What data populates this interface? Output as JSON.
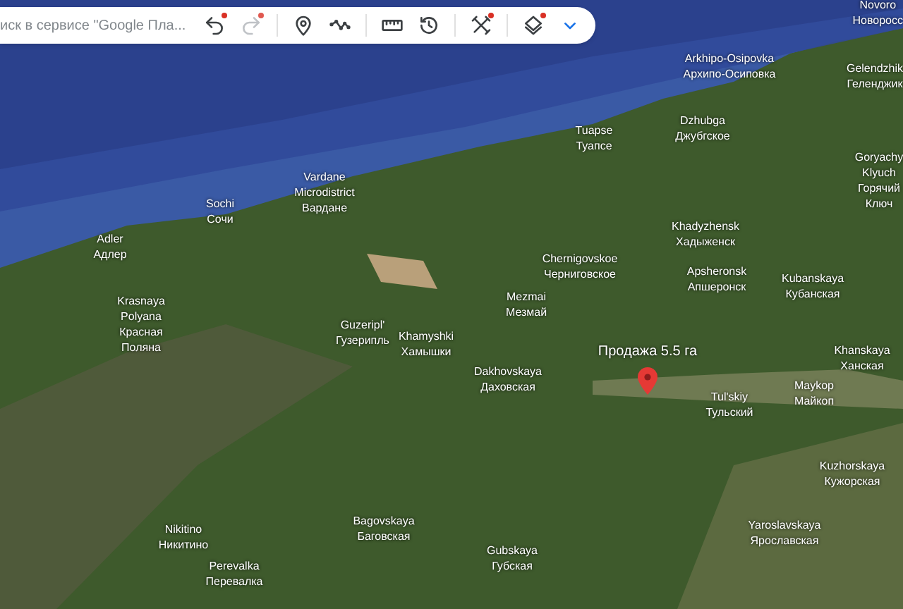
{
  "search": {
    "placeholder": "иск в сервисе \"Google Пла..."
  },
  "toolbar": [
    {
      "kind": "undo",
      "disabled": false,
      "badge": true
    },
    {
      "kind": "redo",
      "disabled": true,
      "badge": true
    },
    {
      "kind": "divider"
    },
    {
      "kind": "pin",
      "disabled": false,
      "badge": false
    },
    {
      "kind": "path",
      "disabled": false,
      "badge": false
    },
    {
      "kind": "divider"
    },
    {
      "kind": "ruler",
      "disabled": false,
      "badge": false
    },
    {
      "kind": "history",
      "disabled": false,
      "badge": false
    },
    {
      "kind": "divider"
    },
    {
      "kind": "tools",
      "disabled": false,
      "badge": true
    },
    {
      "kind": "divider"
    },
    {
      "kind": "layers",
      "disabled": false,
      "badge": true
    },
    {
      "kind": "expand",
      "disabled": false,
      "badge": false
    }
  ],
  "map": {
    "placemark": {
      "label": "Продажа 5.5 га"
    },
    "places": [
      [
        "Novoro",
        "Новоросс"
      ],
      [
        "Arkhipo-Osipovka",
        "Архипо-Осиповка"
      ],
      [
        "Gelendzhik",
        "Геленджик"
      ],
      [
        "Dzhubga",
        "Джубгское"
      ],
      [
        "Tuapse",
        "Туапсе"
      ],
      [
        "Goryachy",
        "Klyuch",
        "Горячий",
        "Ключ"
      ],
      [
        "Vardane",
        "Microdistrict",
        "Вардане"
      ],
      [
        "Sochi",
        "Сочи"
      ],
      [
        "Adler",
        "Адлер"
      ],
      [
        "Khadyzhensk",
        "Хадыженск"
      ],
      [
        "Chernigovskoe",
        "Черниговское"
      ],
      [
        "Apsheronsk",
        "Апшеронск"
      ],
      [
        "Kubanskaya",
        "Кубанская"
      ],
      [
        "Krasnaya",
        "Polyana",
        "Красная",
        "Поляна"
      ],
      [
        "Mezmai",
        "Мезмай"
      ],
      [
        "Guzeripl'",
        "Гузерипль"
      ],
      [
        "Khamyshki",
        "Хамышки"
      ],
      [
        "Dakhovskaya",
        "Даховская"
      ],
      [
        "Khanskaya",
        "Ханская"
      ],
      [
        "Maykop",
        "Майкоп"
      ],
      [
        "Tul'skiy",
        "Тульский"
      ],
      [
        "Kuzhorskaya",
        "Кужорская"
      ],
      [
        "Nikitino",
        "Никитино"
      ],
      [
        "Bagovskaya",
        "Баговская"
      ],
      [
        "Yaroslavskaya",
        "Ярославская"
      ],
      [
        "Perevalka",
        "Перевалка"
      ],
      [
        "Gubskaya",
        "Губская"
      ]
    ]
  }
}
